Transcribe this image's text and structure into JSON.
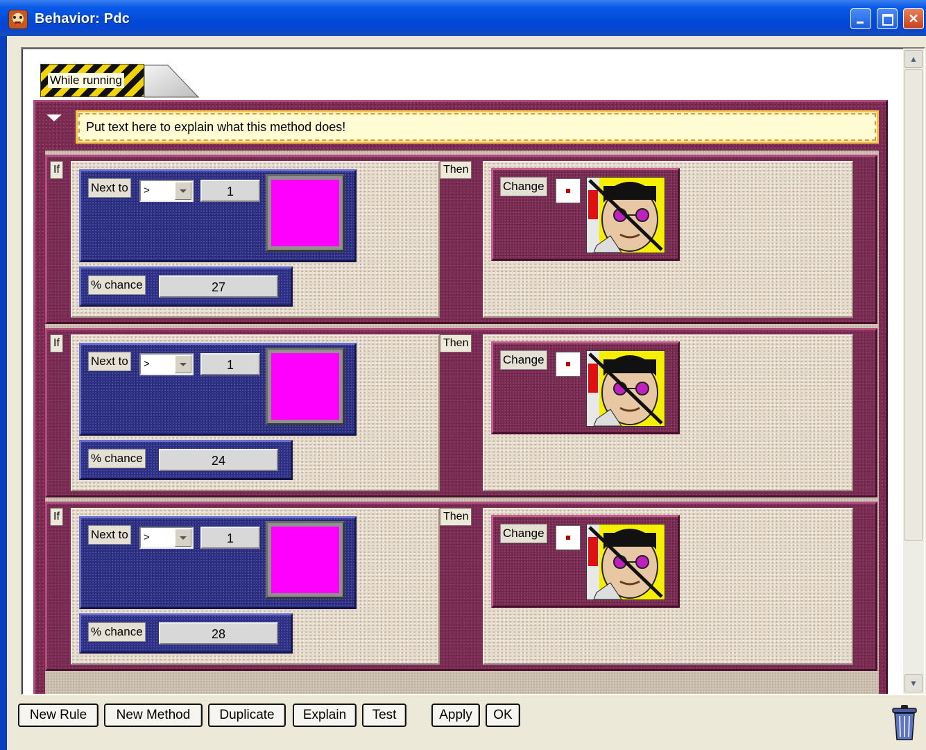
{
  "window": {
    "title": "Behavior: Pdc"
  },
  "method": {
    "tab_label": "While running",
    "comment": "Put text here to explain what this method does!"
  },
  "rules": [
    {
      "if_label": "If",
      "then_label": "Then",
      "next_to": {
        "label": "Next to",
        "operator": ">",
        "count": "1",
        "color": "#ff00ff"
      },
      "chance": {
        "label": "% chance",
        "value": "27"
      },
      "change": {
        "label": "Change"
      }
    },
    {
      "if_label": "If",
      "then_label": "Then",
      "next_to": {
        "label": "Next to",
        "operator": ">",
        "count": "1",
        "color": "#ff00ff"
      },
      "chance": {
        "label": "% chance",
        "value": "24"
      },
      "change": {
        "label": "Change"
      }
    },
    {
      "if_label": "If",
      "then_label": "Then",
      "next_to": {
        "label": "Next to",
        "operator": ">",
        "count": "1",
        "color": "#ff00ff"
      },
      "chance": {
        "label": "% chance",
        "value": "28"
      },
      "change": {
        "label": "Change"
      }
    }
  ],
  "buttons": {
    "new_rule": "New Rule",
    "new_method": "New Method",
    "duplicate": "Duplicate",
    "explain": "Explain",
    "test": "Test",
    "apply": "Apply",
    "ok": "OK"
  },
  "icons": {
    "app": "agent-face-icon",
    "trash": "trash-can-icon",
    "change_target": "agent-with-sunglasses-icon"
  },
  "colors": {
    "title_bar": "#0054e3",
    "method_frame": "#7c2a52",
    "condition_block": "#2d2f86",
    "comment_bg": "#fffbd2",
    "swatch": "#ff00ff"
  }
}
